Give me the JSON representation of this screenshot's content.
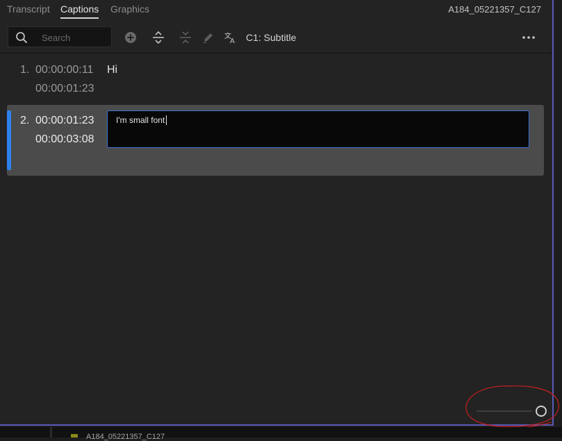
{
  "tabs": [
    {
      "label": "Transcript",
      "active": false
    },
    {
      "label": "Captions",
      "active": true
    },
    {
      "label": "Graphics",
      "active": false
    }
  ],
  "clip_name": "A184_05221357_C127",
  "toolbar": {
    "search_placeholder": "Search",
    "track_label": "C1: Subtitle",
    "icons": [
      "search-icon",
      "add-caption-icon",
      "split-caption-icon",
      "merge-caption-icon",
      "edit-icon",
      "translate-icon",
      "more-icon"
    ]
  },
  "captions": [
    {
      "number": "1.",
      "start": "00:00:00:11",
      "end": "00:00:01:23",
      "text": "Hi",
      "selected": false
    },
    {
      "number": "2.",
      "start": "00:00:01:23",
      "end": "00:00:03:08",
      "text": "I'm small font",
      "selected": true
    }
  ],
  "zoom": {
    "level": 1.0
  },
  "bottom_strip": {
    "clip_name": "A184_05221357_C127"
  },
  "colors": {
    "accent": "#2e82ee",
    "panel_border": "#5a5ab8",
    "annotation": "#cc1f1f"
  }
}
